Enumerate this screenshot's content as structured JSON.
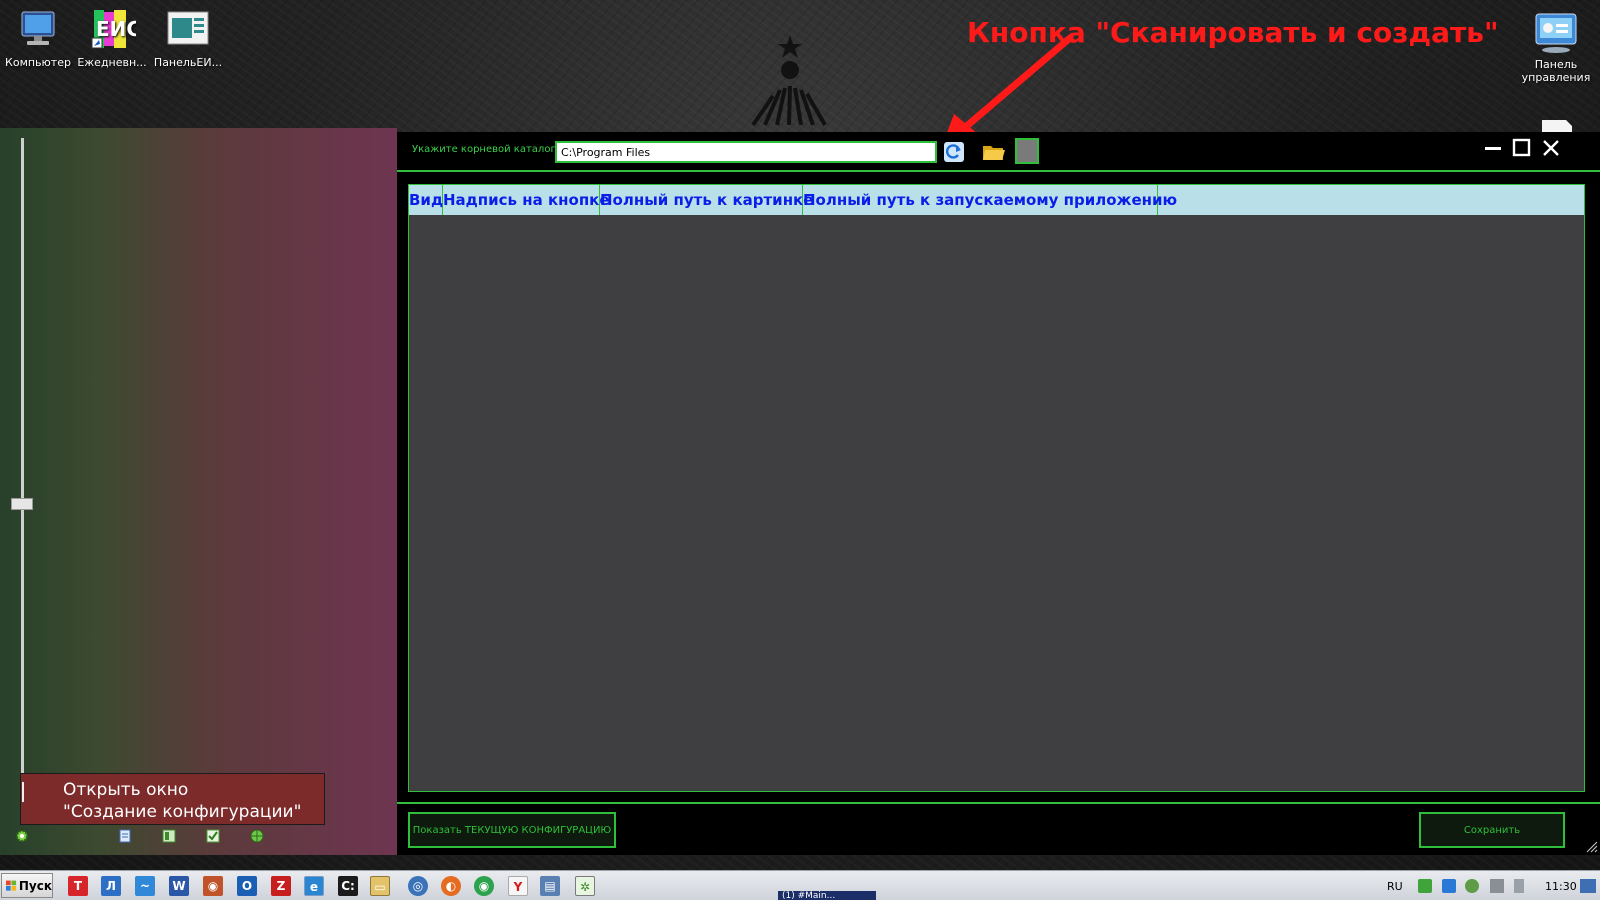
{
  "desktop": {
    "icons": [
      {
        "label": "Компьютер"
      },
      {
        "label": "Ежедневн..."
      },
      {
        "label": "ПанельЕИ..."
      },
      {
        "label": "Панель управления"
      }
    ]
  },
  "annotation": {
    "text": "Кнопка \"Сканировать и создать\"",
    "color": "#ff1a1a"
  },
  "launcher": {
    "tooltip_line1": "Открыть окно",
    "tooltip_line2": "\"Создание конфигурации\""
  },
  "window": {
    "root_label": "Укажите корневой каталог",
    "root_path": "C:\\Program Files",
    "columns": [
      "Вид",
      "Надпись на кнопке",
      "Полный путь к картинке",
      "Полный путь к запускаемому приложению"
    ],
    "show_config_button": "Показать ТЕКУЩУЮ КОНФИГУРАЦИЮ",
    "save_button": "Сохранить",
    "accent_color": "#2fbf3a",
    "header_text_color": "#0a1ee8"
  },
  "taskbar": {
    "start_label": "Пуск",
    "task_label": "(1) #Main...",
    "language": "RU",
    "clock": "11:30"
  }
}
